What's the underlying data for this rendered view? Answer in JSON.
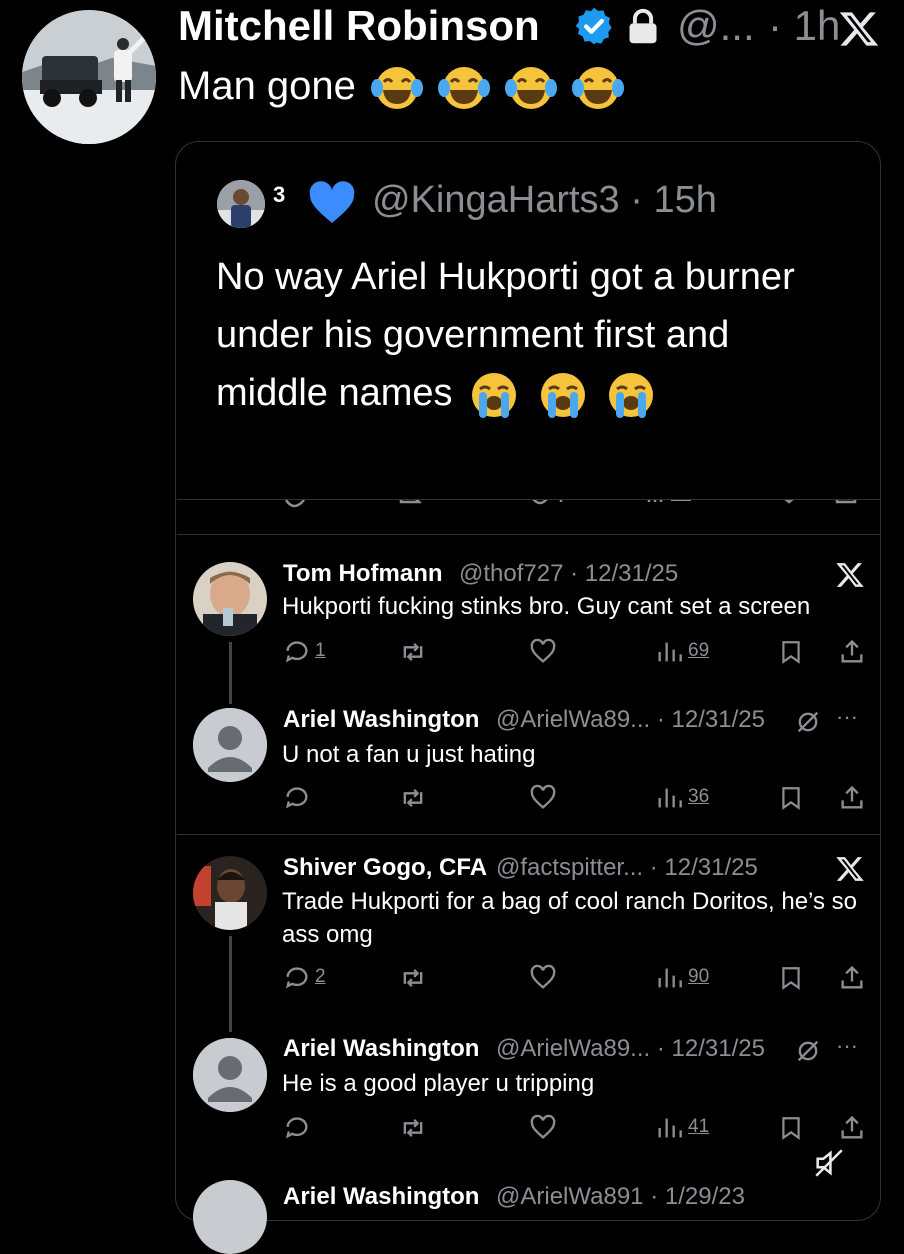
{
  "post": {
    "author_name": "Mitchell Robinson",
    "handle": "@...",
    "time": "· 1h",
    "text": "Man gone",
    "emojis": [
      "tears-of-joy",
      "tears-of-joy",
      "tears-of-joy",
      "tears-of-joy"
    ]
  },
  "quote": {
    "author_sup": "3",
    "handle": "@KingaHarts3 · 15h",
    "text": "No way Ariel Hukporti got a burner under his government first and middle names",
    "emojis": [
      "loudly-crying",
      "loudly-crying",
      "loudly-crying"
    ]
  },
  "replies": [
    {
      "name": "Tom Hofmann",
      "handle": "@thof727 · 12/31/25",
      "text": "Hukporti fucking stinks bro. Guy cant set a screen",
      "reply_count": "1",
      "view_count": "69"
    },
    {
      "name": "Ariel Washington",
      "handle": "@ArielWa89... · 12/31/25",
      "text": "U not a fan u just hating",
      "reply_count": "",
      "view_count": "36",
      "more": "···"
    },
    {
      "name": "Shiver Gogo, CFA",
      "handle": "@factspitter... · 12/31/25",
      "text": "Trade Hukporti for a bag of cool ranch Doritos, he’s so ass omg",
      "reply_count": "2",
      "view_count": "90"
    },
    {
      "name": "Ariel Washington",
      "handle": "@ArielWa89... · 12/31/25",
      "text": "He is a good player u tripping",
      "reply_count": "",
      "view_count": "41",
      "more": "···"
    },
    {
      "name": "Ariel Washington",
      "handle": "@ArielWa891 · 1/29/23",
      "text": ""
    }
  ],
  "colors": {
    "background": "#000000",
    "text": "#e7e9ea",
    "muted": "#8b8f94",
    "verified": "#1d9bf0",
    "heart": "#3b8dff",
    "border": "#2f3336"
  }
}
